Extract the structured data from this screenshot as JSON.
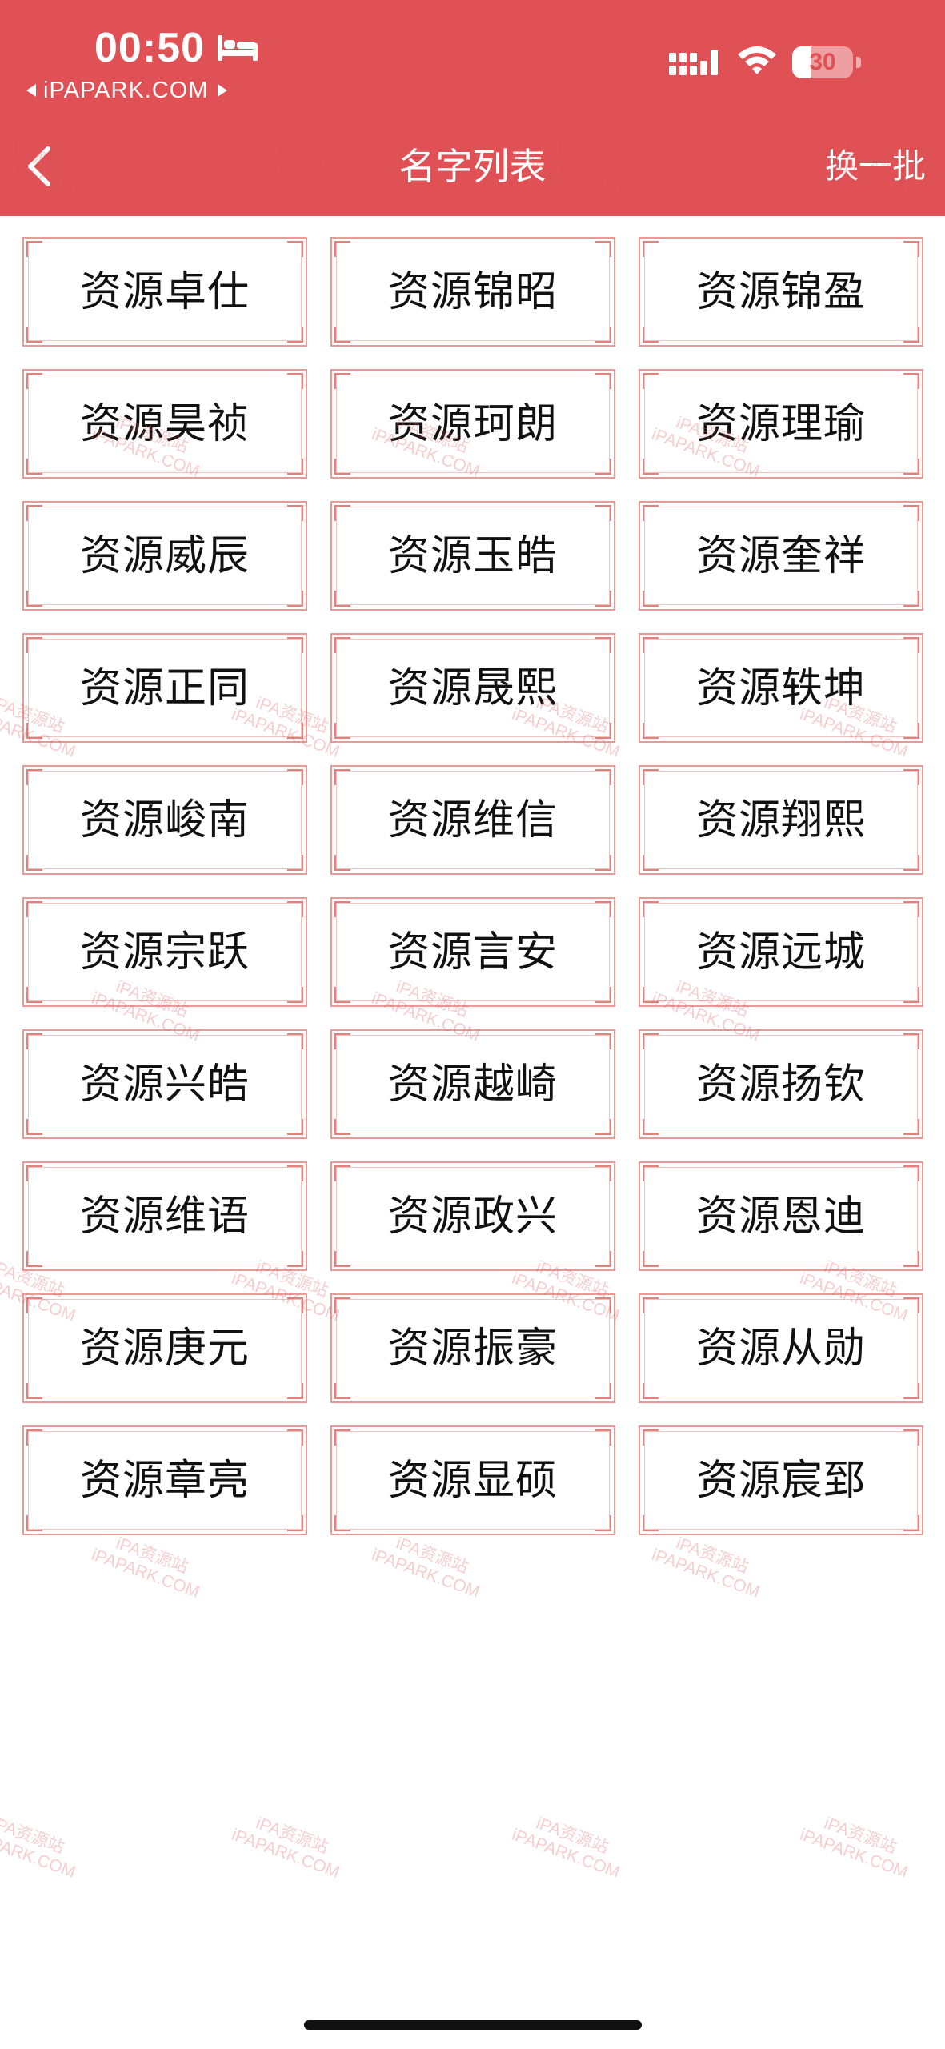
{
  "status_bar": {
    "time": "00:50",
    "back_to_app": "iPAPARK.COM",
    "battery_level": "30",
    "battery_fraction": 0.3
  },
  "nav": {
    "title": "名字列表",
    "refresh_label": "换一批"
  },
  "names": [
    "资源卓仕",
    "资源锦昭",
    "资源锦盈",
    "资源昊祯",
    "资源珂朗",
    "资源理瑜",
    "资源威辰",
    "资源玉皓",
    "资源奎祥",
    "资源正同",
    "资源晟熙",
    "资源轶坤",
    "资源峻南",
    "资源维信",
    "资源翔熙",
    "资源宗跃",
    "资源言安",
    "资源远城",
    "资源兴皓",
    "资源越崎",
    "资源扬钦",
    "资源维语",
    "资源政兴",
    "资源恩迪",
    "资源庚元",
    "资源振豪",
    "资源从勋",
    "资源章亮",
    "资源显硕",
    "资源宸郅"
  ],
  "watermark": {
    "line1": "iPA资源站",
    "line2": "iPAPARK.COM"
  },
  "colors": {
    "header": "#e05155",
    "card_border": "#e89a96",
    "name_text": "#111111"
  }
}
